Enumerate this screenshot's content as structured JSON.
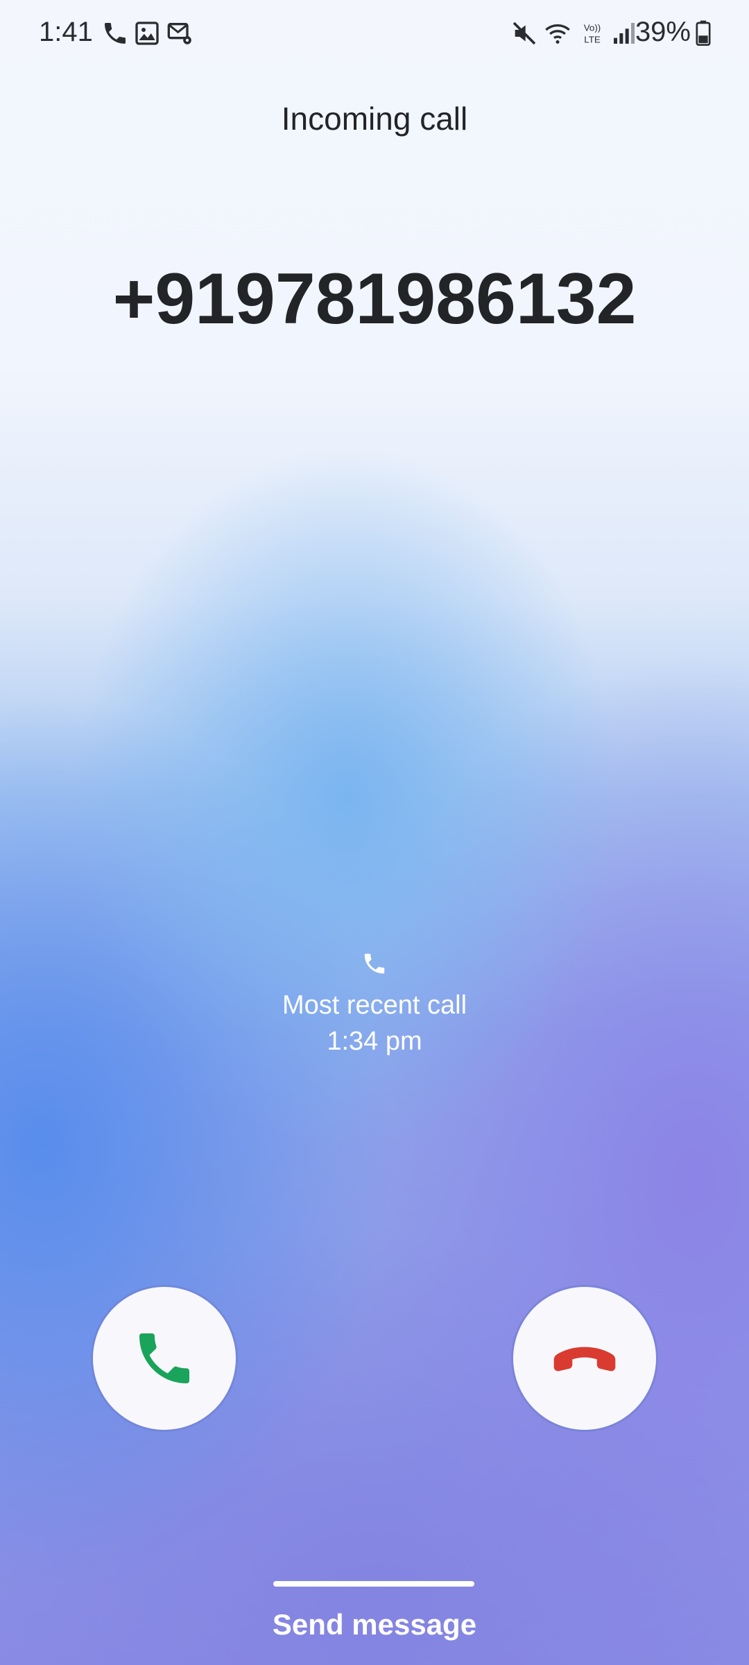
{
  "status_bar": {
    "time": "1:41",
    "battery": "39%",
    "left_icons": [
      "phone-icon",
      "image-icon",
      "email-settings-icon"
    ],
    "right_icons": [
      "mute-icon",
      "wifi-icon",
      "volte-icon",
      "signal-icon",
      "battery-icon"
    ]
  },
  "call": {
    "title": "Incoming call",
    "number": "+919781986132",
    "recent_label": "Most recent call",
    "recent_time": "1:34 pm"
  },
  "actions": {
    "accept_icon": "phone-accept-icon",
    "accept_color": "#1aa35a",
    "decline_icon": "phone-decline-icon",
    "decline_color": "#d93b30",
    "send_message": "Send message"
  }
}
